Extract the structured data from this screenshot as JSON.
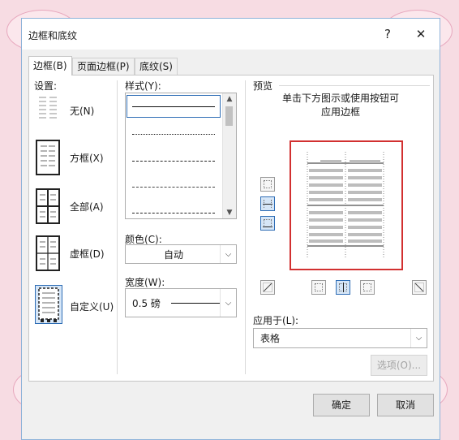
{
  "window": {
    "title": "边框和底纹",
    "help_glyph": "?",
    "close_glyph": "✕"
  },
  "tabs": [
    {
      "label": "边框(B)",
      "active": true
    },
    {
      "label": "页面边框(P)",
      "active": false
    },
    {
      "label": "底纹(S)",
      "active": false
    }
  ],
  "settings": {
    "heading": "设置:",
    "items": [
      {
        "label": "无(N)",
        "icon": "none-setting-icon"
      },
      {
        "label": "方框(X)",
        "icon": "box-setting-icon"
      },
      {
        "label": "全部(A)",
        "icon": "all-setting-icon"
      },
      {
        "label": "虚框(D)",
        "icon": "grid-setting-icon"
      },
      {
        "label": "自定义(U)",
        "icon": "custom-setting-icon",
        "selected": true
      }
    ]
  },
  "style": {
    "heading": "样式(Y):"
  },
  "color": {
    "heading": "颜色(C):",
    "value": "自动"
  },
  "width": {
    "heading": "宽度(W):",
    "value": "0.5 磅"
  },
  "preview": {
    "heading": "预览",
    "hint_line1": "单击下方图示或使用按钮可",
    "hint_line2": "应用边框"
  },
  "apply_to": {
    "heading": "应用于(L):",
    "value": "表格"
  },
  "buttons": {
    "options": "选项(O)...",
    "ok": "确定",
    "cancel": "取消"
  },
  "colors": {
    "selection_frame": "#d23030",
    "accent": "#2e6db5"
  }
}
